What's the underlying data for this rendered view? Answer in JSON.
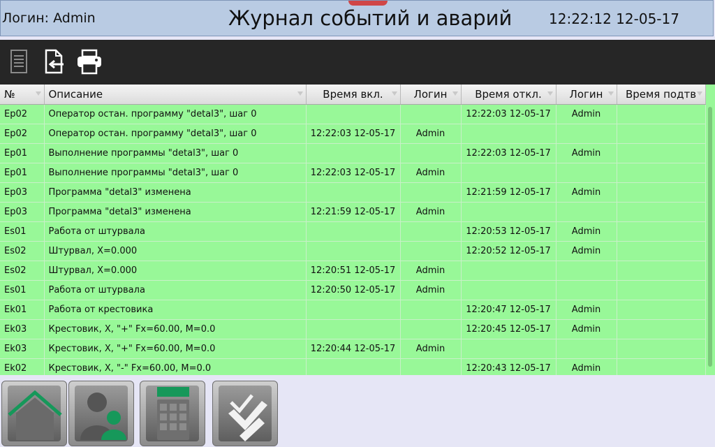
{
  "header": {
    "login": "Логин: Admin",
    "title": "Журнал событий и аварий",
    "datetime": "12:22:12 12-05-17"
  },
  "toolbar": {
    "icons": [
      "document-list-icon",
      "export-icon",
      "print-icon"
    ]
  },
  "table": {
    "headers": [
      "№",
      "Описание",
      "Время вкл.",
      "Логин",
      "Время откл.",
      "Логин",
      "Время подтв"
    ],
    "rows": [
      {
        "code": "Ep02",
        "desc": "Оператор остан. программу \"detal3\", шаг 0",
        "on": "",
        "login_on": "",
        "off": "12:22:03 12-05-17",
        "login_off": "Admin",
        "ack": ""
      },
      {
        "code": "Ep02",
        "desc": "Оператор остан. программу \"detal3\", шаг 0",
        "on": "12:22:03 12-05-17",
        "login_on": "Admin",
        "off": "",
        "login_off": "",
        "ack": ""
      },
      {
        "code": "Ep01",
        "desc": "Выполнение программы \"detal3\", шаг 0",
        "on": "",
        "login_on": "",
        "off": "12:22:03 12-05-17",
        "login_off": "Admin",
        "ack": ""
      },
      {
        "code": "Ep01",
        "desc": "Выполнение программы \"detal3\", шаг 0",
        "on": "12:22:03 12-05-17",
        "login_on": "Admin",
        "off": "",
        "login_off": "",
        "ack": ""
      },
      {
        "code": "Ep03",
        "desc": "Программа \"detal3\" изменена",
        "on": "",
        "login_on": "",
        "off": "12:21:59 12-05-17",
        "login_off": "Admin",
        "ack": ""
      },
      {
        "code": "Ep03",
        "desc": "Программа \"detal3\" изменена",
        "on": "12:21:59 12-05-17",
        "login_on": "Admin",
        "off": "",
        "login_off": "",
        "ack": ""
      },
      {
        "code": "Es01",
        "desc": "Работа от штурвала",
        "on": "",
        "login_on": "",
        "off": "12:20:53 12-05-17",
        "login_off": "Admin",
        "ack": ""
      },
      {
        "code": "Es02",
        "desc": "Штурвал, X=0.000",
        "on": "",
        "login_on": "",
        "off": "12:20:52 12-05-17",
        "login_off": "Admin",
        "ack": ""
      },
      {
        "code": "Es02",
        "desc": "Штурвал, X=0.000",
        "on": "12:20:51 12-05-17",
        "login_on": "Admin",
        "off": "",
        "login_off": "",
        "ack": ""
      },
      {
        "code": "Es01",
        "desc": "Работа от штурвала",
        "on": "12:20:50 12-05-17",
        "login_on": "Admin",
        "off": "",
        "login_off": "",
        "ack": ""
      },
      {
        "code": "Ek01",
        "desc": "Работа от крестовика",
        "on": "",
        "login_on": "",
        "off": "12:20:47 12-05-17",
        "login_off": "Admin",
        "ack": ""
      },
      {
        "code": "Ek03",
        "desc": "Крестовик, X, \"+\" Fx=60.00, M=0.0",
        "on": "",
        "login_on": "",
        "off": "12:20:45 12-05-17",
        "login_off": "Admin",
        "ack": ""
      },
      {
        "code": "Ek03",
        "desc": "Крестовик, X, \"+\" Fx=60.00, M=0.0",
        "on": "12:20:44 12-05-17",
        "login_on": "Admin",
        "off": "",
        "login_off": "",
        "ack": ""
      },
      {
        "code": "Ek02",
        "desc": "Крестовик, X, \"-\" Fx=60.00, M=0.0",
        "on": "",
        "login_on": "",
        "off": "12:20:43 12-05-17",
        "login_off": "Admin",
        "ack": ""
      }
    ]
  },
  "nav": {
    "icons": [
      "home-icon",
      "users-icon",
      "calculator-icon",
      "checklist-icon"
    ]
  },
  "colors": {
    "row_bg": "#98f898",
    "header_bg": "#b9cbe3",
    "toolbar_bg": "#262626",
    "accent_green": "#16985a"
  }
}
